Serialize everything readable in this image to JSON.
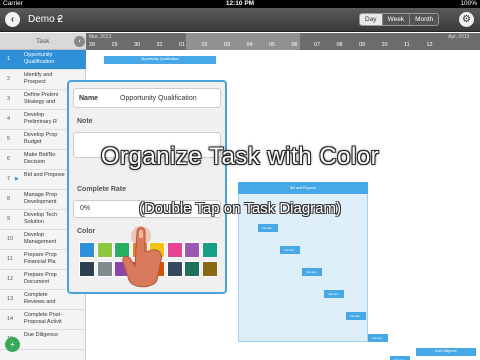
{
  "status": {
    "carrier": "Carrier",
    "time": "12:10 PM",
    "battery": "100%"
  },
  "nav": {
    "title": "Demo 2",
    "caret": "▾",
    "back_icon": "back-arrow-icon",
    "segments": [
      {
        "label": "Day",
        "active": true
      },
      {
        "label": "Week",
        "active": false
      },
      {
        "label": "Month",
        "active": false
      }
    ],
    "settings_icon": "gear-icon"
  },
  "task_column": {
    "header": "Task",
    "tasks": [
      {
        "num": "1",
        "name": "Opportunity\nQualification",
        "selected": true
      },
      {
        "num": "2",
        "name": "Identify and\nProspect"
      },
      {
        "num": "3",
        "name": "Define Prelimi\nStrategy and"
      },
      {
        "num": "4",
        "name": "Develop\nPreliminary R"
      },
      {
        "num": "5",
        "name": "Develop Prop\nBudget"
      },
      {
        "num": "6",
        "name": "Make Bid/No\nDecision"
      },
      {
        "num": "7",
        "name": "Bid and Propose",
        "arrow": true
      },
      {
        "num": "8",
        "name": "Manage Prop\nDevelopment"
      },
      {
        "num": "9",
        "name": "Develop Tech\nSolution"
      },
      {
        "num": "10",
        "name": "Develop\nManagement"
      },
      {
        "num": "11",
        "name": "Prepare Prop\nFinancial Pla"
      },
      {
        "num": "12",
        "name": "Prepare Prop\nDocument"
      },
      {
        "num": "13",
        "name": "Complete\nReviews and"
      },
      {
        "num": "14",
        "name": "Complete Post-\nProposal Activit"
      },
      {
        "num": "15",
        "name": "Due Diligence"
      }
    ]
  },
  "timeline": {
    "month_left": "Mar, 2013",
    "month_right": "Apr, 2013",
    "days": [
      "28",
      "29",
      "30",
      "31",
      "01",
      "02",
      "03",
      "04",
      "05",
      "06",
      "07",
      "08",
      "09",
      "10",
      "11",
      "12"
    ],
    "bar_label": "Opportunity Qualification",
    "group_label": "Bid and Propose",
    "subtask_label": "Develo..",
    "bottom_bar_label": "Due Diligence"
  },
  "popover": {
    "name_label": "Name",
    "name_value": "Opportunity Qualification",
    "note_label": "Note",
    "rate_label": "Complete Rate",
    "rate_value": "0%",
    "color_label": "Color",
    "swatches": [
      "#2f8fd8",
      "#8dc63f",
      "#27ae60",
      "#e67e22",
      "#f1c40f",
      "#e84393",
      "#9b59b6",
      "#16a085",
      "#2c3e50",
      "#7f8c8d",
      "#8e44ad",
      "#c0392b",
      "#d35400",
      "#34495e",
      "#1e6f5c",
      "#8b6914"
    ]
  },
  "overlay": {
    "title": "Organize Task with Color",
    "subtitle": "(Double Tap on Task Diagram)"
  },
  "add_icon": "add-icon"
}
